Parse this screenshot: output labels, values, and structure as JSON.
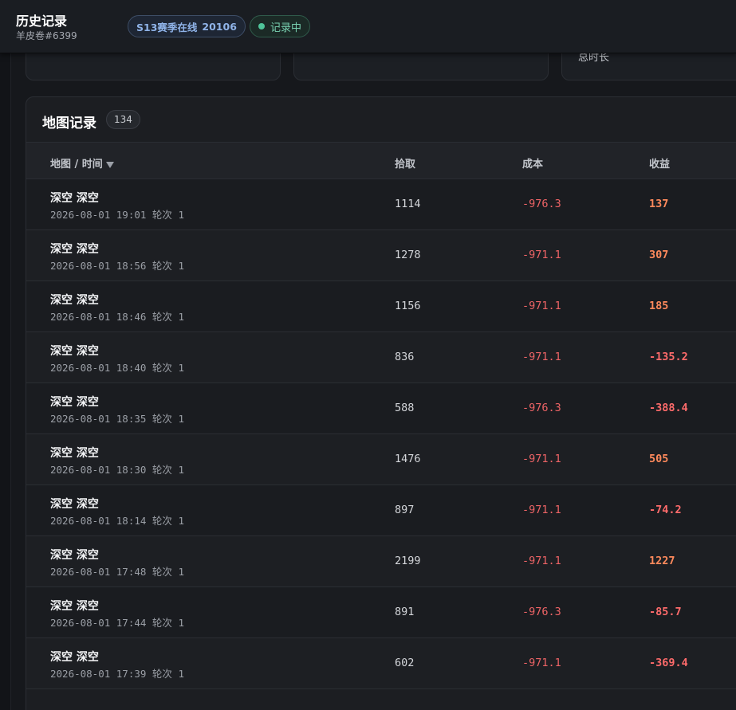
{
  "header": {
    "title": "历史记录",
    "subtitle": "羊皮卷#6399",
    "season_label": "S13赛季在线",
    "season_count": "20106",
    "status_label": "记录中",
    "status_color": "#4fc59a"
  },
  "stat_cards": [
    {
      "label": ""
    },
    {
      "label": ""
    },
    {
      "label": "总时长"
    }
  ],
  "map_records": {
    "title": "地图记录",
    "count": "134",
    "columns": {
      "map_time": "地图 / 时间",
      "pickup": "拾取",
      "cost": "成本",
      "profit": "收益"
    },
    "rows": [
      {
        "map": "深空 深空",
        "time": "2026-08-01 19:01 轮次 1",
        "pickup": "1114",
        "cost": "-976.3",
        "profit": "137"
      },
      {
        "map": "深空 深空",
        "time": "2026-08-01 18:56 轮次 1",
        "pickup": "1278",
        "cost": "-971.1",
        "profit": "307"
      },
      {
        "map": "深空 深空",
        "time": "2026-08-01 18:46 轮次 1",
        "pickup": "1156",
        "cost": "-971.1",
        "profit": "185"
      },
      {
        "map": "深空 深空",
        "time": "2026-08-01 18:40 轮次 1",
        "pickup": "836",
        "cost": "-971.1",
        "profit": "-135.2"
      },
      {
        "map": "深空 深空",
        "time": "2026-08-01 18:35 轮次 1",
        "pickup": "588",
        "cost": "-976.3",
        "profit": "-388.4"
      },
      {
        "map": "深空 深空",
        "time": "2026-08-01 18:30 轮次 1",
        "pickup": "1476",
        "cost": "-971.1",
        "profit": "505"
      },
      {
        "map": "深空 深空",
        "time": "2026-08-01 18:14 轮次 1",
        "pickup": "897",
        "cost": "-971.1",
        "profit": "-74.2"
      },
      {
        "map": "深空 深空",
        "time": "2026-08-01 17:48 轮次 1",
        "pickup": "2199",
        "cost": "-971.1",
        "profit": "1227"
      },
      {
        "map": "深空 深空",
        "time": "2026-08-01 17:44 轮次 1",
        "pickup": "891",
        "cost": "-976.3",
        "profit": "-85.7"
      },
      {
        "map": "深空 深空",
        "time": "2026-08-01 17:39 轮次 1",
        "pickup": "602",
        "cost": "-971.1",
        "profit": "-369.4"
      }
    ]
  }
}
